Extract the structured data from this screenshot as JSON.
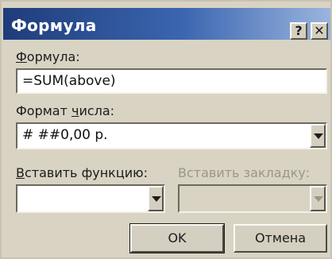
{
  "window": {
    "title": "Формула",
    "help_label": "?",
    "close_label": "✕"
  },
  "formula": {
    "label_underlined": "Ф",
    "label_rest": "ормула:",
    "value": "=SUM(above)"
  },
  "number_format": {
    "label_start": "Формат ",
    "label_underlined": "ч",
    "label_rest": "исла:",
    "value": "# ##0,00 р."
  },
  "paste_function": {
    "label_underlined": "В",
    "label_rest": "ставить функцию:",
    "value": ""
  },
  "paste_bookmark": {
    "label": "Вставить закладку:",
    "value": ""
  },
  "buttons": {
    "ok": "OK",
    "cancel": "Отмена"
  },
  "icons": {
    "dropdown": "chevron-down-icon",
    "help": "help-icon",
    "close": "close-icon"
  }
}
